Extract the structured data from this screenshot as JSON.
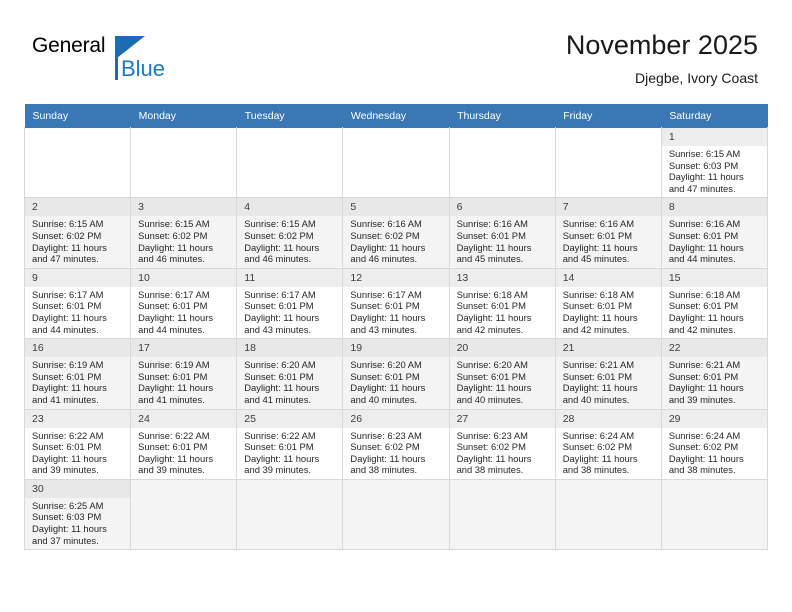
{
  "brand": {
    "name_top": "General",
    "name_bottom": "Blue",
    "triangle_icon": "logo-triangle-icon",
    "color_blue": "#1b78c4",
    "color_dark_blue": "#1b6cb3"
  },
  "header": {
    "title": "November 2025",
    "subtitle": "Djegbe, Ivory Coast"
  },
  "theme": {
    "header_row_bg": "#3a78b5",
    "header_row_text": "#ffffff",
    "band_shaded_bg": "#f4f4f4",
    "daynum_bg": "#ededed",
    "grid_border": "#d9d9d9",
    "week_divider": "#3a78b5"
  },
  "weekday_headers": [
    "Sunday",
    "Monday",
    "Tuesday",
    "Wednesday",
    "Thursday",
    "Friday",
    "Saturday"
  ],
  "labels": {
    "sunrise_prefix": "Sunrise:",
    "sunset_prefix": "Sunset:",
    "daylight_prefix": "Daylight:"
  },
  "weeks": [
    {
      "shaded": false,
      "days": [
        {
          "empty": true
        },
        {
          "empty": true
        },
        {
          "empty": true
        },
        {
          "empty": true
        },
        {
          "empty": true
        },
        {
          "empty": true
        },
        {
          "empty": false,
          "date": "1",
          "sunrise": "Sunrise: 6:15 AM",
          "sunset": "Sunset: 6:03 PM",
          "daylight_line1": "Daylight: 11 hours",
          "daylight_line2": "and 47 minutes."
        }
      ]
    },
    {
      "shaded": true,
      "days": [
        {
          "empty": false,
          "date": "2",
          "sunrise": "Sunrise: 6:15 AM",
          "sunset": "Sunset: 6:02 PM",
          "daylight_line1": "Daylight: 11 hours",
          "daylight_line2": "and 47 minutes."
        },
        {
          "empty": false,
          "date": "3",
          "sunrise": "Sunrise: 6:15 AM",
          "sunset": "Sunset: 6:02 PM",
          "daylight_line1": "Daylight: 11 hours",
          "daylight_line2": "and 46 minutes."
        },
        {
          "empty": false,
          "date": "4",
          "sunrise": "Sunrise: 6:15 AM",
          "sunset": "Sunset: 6:02 PM",
          "daylight_line1": "Daylight: 11 hours",
          "daylight_line2": "and 46 minutes."
        },
        {
          "empty": false,
          "date": "5",
          "sunrise": "Sunrise: 6:16 AM",
          "sunset": "Sunset: 6:02 PM",
          "daylight_line1": "Daylight: 11 hours",
          "daylight_line2": "and 46 minutes."
        },
        {
          "empty": false,
          "date": "6",
          "sunrise": "Sunrise: 6:16 AM",
          "sunset": "Sunset: 6:01 PM",
          "daylight_line1": "Daylight: 11 hours",
          "daylight_line2": "and 45 minutes."
        },
        {
          "empty": false,
          "date": "7",
          "sunrise": "Sunrise: 6:16 AM",
          "sunset": "Sunset: 6:01 PM",
          "daylight_line1": "Daylight: 11 hours",
          "daylight_line2": "and 45 minutes."
        },
        {
          "empty": false,
          "date": "8",
          "sunrise": "Sunrise: 6:16 AM",
          "sunset": "Sunset: 6:01 PM",
          "daylight_line1": "Daylight: 11 hours",
          "daylight_line2": "and 44 minutes."
        }
      ]
    },
    {
      "shaded": false,
      "days": [
        {
          "empty": false,
          "date": "9",
          "sunrise": "Sunrise: 6:17 AM",
          "sunset": "Sunset: 6:01 PM",
          "daylight_line1": "Daylight: 11 hours",
          "daylight_line2": "and 44 minutes."
        },
        {
          "empty": false,
          "date": "10",
          "sunrise": "Sunrise: 6:17 AM",
          "sunset": "Sunset: 6:01 PM",
          "daylight_line1": "Daylight: 11 hours",
          "daylight_line2": "and 44 minutes."
        },
        {
          "empty": false,
          "date": "11",
          "sunrise": "Sunrise: 6:17 AM",
          "sunset": "Sunset: 6:01 PM",
          "daylight_line1": "Daylight: 11 hours",
          "daylight_line2": "and 43 minutes."
        },
        {
          "empty": false,
          "date": "12",
          "sunrise": "Sunrise: 6:17 AM",
          "sunset": "Sunset: 6:01 PM",
          "daylight_line1": "Daylight: 11 hours",
          "daylight_line2": "and 43 minutes."
        },
        {
          "empty": false,
          "date": "13",
          "sunrise": "Sunrise: 6:18 AM",
          "sunset": "Sunset: 6:01 PM",
          "daylight_line1": "Daylight: 11 hours",
          "daylight_line2": "and 42 minutes."
        },
        {
          "empty": false,
          "date": "14",
          "sunrise": "Sunrise: 6:18 AM",
          "sunset": "Sunset: 6:01 PM",
          "daylight_line1": "Daylight: 11 hours",
          "daylight_line2": "and 42 minutes."
        },
        {
          "empty": false,
          "date": "15",
          "sunrise": "Sunrise: 6:18 AM",
          "sunset": "Sunset: 6:01 PM",
          "daylight_line1": "Daylight: 11 hours",
          "daylight_line2": "and 42 minutes."
        }
      ]
    },
    {
      "shaded": true,
      "days": [
        {
          "empty": false,
          "date": "16",
          "sunrise": "Sunrise: 6:19 AM",
          "sunset": "Sunset: 6:01 PM",
          "daylight_line1": "Daylight: 11 hours",
          "daylight_line2": "and 41 minutes."
        },
        {
          "empty": false,
          "date": "17",
          "sunrise": "Sunrise: 6:19 AM",
          "sunset": "Sunset: 6:01 PM",
          "daylight_line1": "Daylight: 11 hours",
          "daylight_line2": "and 41 minutes."
        },
        {
          "empty": false,
          "date": "18",
          "sunrise": "Sunrise: 6:20 AM",
          "sunset": "Sunset: 6:01 PM",
          "daylight_line1": "Daylight: 11 hours",
          "daylight_line2": "and 41 minutes."
        },
        {
          "empty": false,
          "date": "19",
          "sunrise": "Sunrise: 6:20 AM",
          "sunset": "Sunset: 6:01 PM",
          "daylight_line1": "Daylight: 11 hours",
          "daylight_line2": "and 40 minutes."
        },
        {
          "empty": false,
          "date": "20",
          "sunrise": "Sunrise: 6:20 AM",
          "sunset": "Sunset: 6:01 PM",
          "daylight_line1": "Daylight: 11 hours",
          "daylight_line2": "and 40 minutes."
        },
        {
          "empty": false,
          "date": "21",
          "sunrise": "Sunrise: 6:21 AM",
          "sunset": "Sunset: 6:01 PM",
          "daylight_line1": "Daylight: 11 hours",
          "daylight_line2": "and 40 minutes."
        },
        {
          "empty": false,
          "date": "22",
          "sunrise": "Sunrise: 6:21 AM",
          "sunset": "Sunset: 6:01 PM",
          "daylight_line1": "Daylight: 11 hours",
          "daylight_line2": "and 39 minutes."
        }
      ]
    },
    {
      "shaded": false,
      "days": [
        {
          "empty": false,
          "date": "23",
          "sunrise": "Sunrise: 6:22 AM",
          "sunset": "Sunset: 6:01 PM",
          "daylight_line1": "Daylight: 11 hours",
          "daylight_line2": "and 39 minutes."
        },
        {
          "empty": false,
          "date": "24",
          "sunrise": "Sunrise: 6:22 AM",
          "sunset": "Sunset: 6:01 PM",
          "daylight_line1": "Daylight: 11 hours",
          "daylight_line2": "and 39 minutes."
        },
        {
          "empty": false,
          "date": "25",
          "sunrise": "Sunrise: 6:22 AM",
          "sunset": "Sunset: 6:01 PM",
          "daylight_line1": "Daylight: 11 hours",
          "daylight_line2": "and 39 minutes."
        },
        {
          "empty": false,
          "date": "26",
          "sunrise": "Sunrise: 6:23 AM",
          "sunset": "Sunset: 6:02 PM",
          "daylight_line1": "Daylight: 11 hours",
          "daylight_line2": "and 38 minutes."
        },
        {
          "empty": false,
          "date": "27",
          "sunrise": "Sunrise: 6:23 AM",
          "sunset": "Sunset: 6:02 PM",
          "daylight_line1": "Daylight: 11 hours",
          "daylight_line2": "and 38 minutes."
        },
        {
          "empty": false,
          "date": "28",
          "sunrise": "Sunrise: 6:24 AM",
          "sunset": "Sunset: 6:02 PM",
          "daylight_line1": "Daylight: 11 hours",
          "daylight_line2": "and 38 minutes."
        },
        {
          "empty": false,
          "date": "29",
          "sunrise": "Sunrise: 6:24 AM",
          "sunset": "Sunset: 6:02 PM",
          "daylight_line1": "Daylight: 11 hours",
          "daylight_line2": "and 38 minutes."
        }
      ]
    },
    {
      "shaded": true,
      "days": [
        {
          "empty": false,
          "date": "30",
          "sunrise": "Sunrise: 6:25 AM",
          "sunset": "Sunset: 6:03 PM",
          "daylight_line1": "Daylight: 11 hours",
          "daylight_line2": "and 37 minutes."
        },
        {
          "empty": true
        },
        {
          "empty": true
        },
        {
          "empty": true
        },
        {
          "empty": true
        },
        {
          "empty": true
        },
        {
          "empty": true
        }
      ]
    }
  ]
}
